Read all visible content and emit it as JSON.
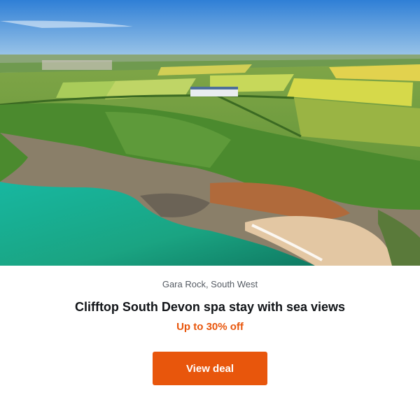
{
  "hero": {
    "image_alt": "Aerial view of clifftop hotel above a sandy cove with turquoise sea and green fields"
  },
  "card": {
    "location": "Gara Rock, South West",
    "title": "Clifftop South Devon spa stay with sea views",
    "offer": "Up to 30% off",
    "cta_label": "View deal"
  },
  "colors": {
    "accent": "#e8560c",
    "offer_text": "#e8560c",
    "title_text": "#111418",
    "location_text": "#555b63"
  }
}
